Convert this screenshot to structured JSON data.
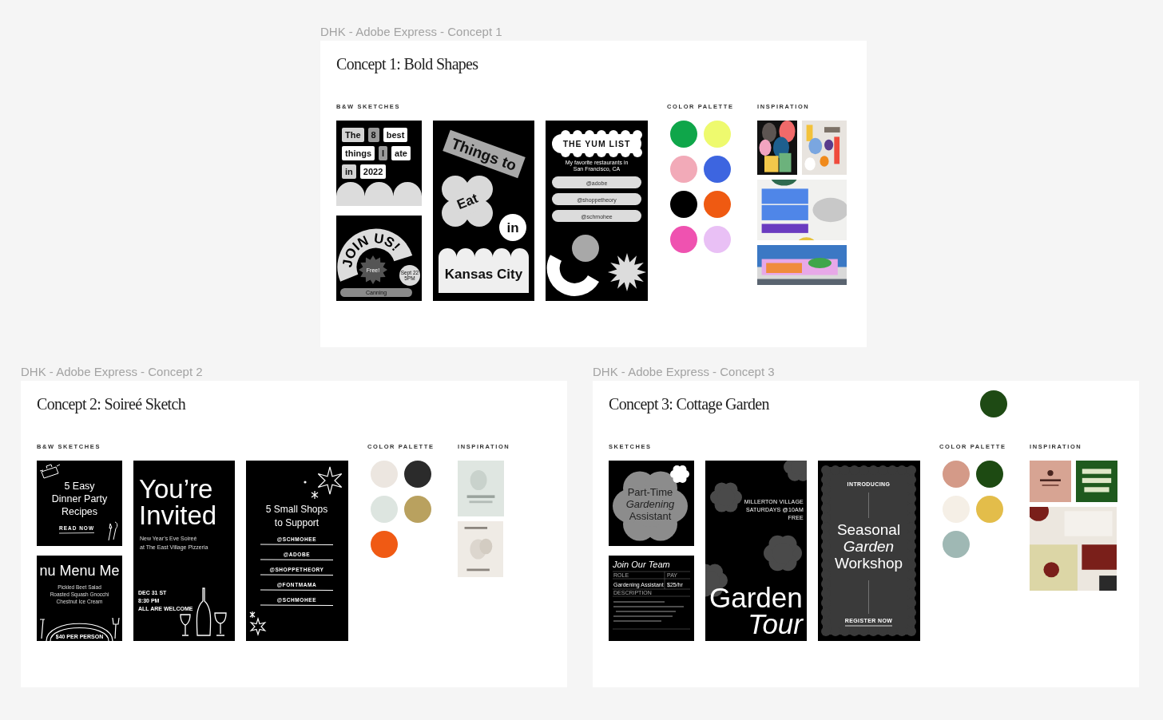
{
  "concepts": [
    {
      "label": "DHK - Adobe Express - Concept 1",
      "title": "Concept 1: Bold Shapes",
      "sketches_heading": "B&W SKETCHES",
      "palette_heading": "COLOR PALETTE",
      "inspiration_heading": "INSPIRATION",
      "sketches": [
        {
          "kind": "word-tiles",
          "rows": [
            [
              {
                "text": "The",
                "color": "#d4d4d4"
              },
              {
                "text": "8",
                "color": "#9a9a9a"
              },
              {
                "text": "best",
                "color": "#ffffff"
              }
            ],
            [
              {
                "text": "things",
                "color": "#ffffff"
              },
              {
                "text": "I",
                "color": "#9a9a9a"
              },
              {
                "text": "ate",
                "color": "#ffffff"
              }
            ],
            [
              {
                "text": "in",
                "color": "#d4d4d4"
              },
              {
                "text": "2022",
                "color": "#ffffff"
              }
            ]
          ]
        },
        {
          "kind": "join-us",
          "arc": "JOIN US!",
          "badge": "Free!",
          "date": [
            "Sept 22",
            "5PM"
          ],
          "bar": "Canning"
        },
        {
          "kind": "things-to-eat",
          "banner": "Things to",
          "flower": "Eat",
          "circle": "in",
          "box": "Kansas City"
        },
        {
          "kind": "yum-list",
          "title": "THE YUM LIST",
          "subtitle": [
            "My favorite restaurants in",
            "San Francisco, CA"
          ],
          "handles": [
            "@adobe",
            "@shoppetheory",
            "@schmohee"
          ]
        }
      ],
      "palette": [
        {
          "color": "#0fa64a"
        },
        {
          "color": "#eefa6e"
        },
        {
          "color": "#f2aab8"
        },
        {
          "color": "#3d65e0"
        },
        {
          "color": "#000000"
        },
        {
          "color": "#ef5a12"
        },
        {
          "color": "#ef52b0"
        },
        {
          "color": "#e9c0f5"
        }
      ],
      "inspiration": [
        {
          "kind": "picture"
        },
        {
          "kind": "picture"
        },
        {
          "kind": "picture"
        },
        {
          "kind": "picture"
        }
      ]
    },
    {
      "label": "DHK - Adobe Express - Concept 2",
      "title": "Concept 2: Soireé Sketch",
      "sketches_heading": "B&W SKETCHES",
      "palette_heading": "COLOR PALETTE",
      "inspiration_heading": "INSPIRATION",
      "sketches": [
        {
          "kind": "recipes",
          "title": [
            "5 Easy",
            "Dinner Party",
            "Recipes"
          ],
          "link": "READ NOW"
        },
        {
          "kind": "menu",
          "title": "nu Menu Me",
          "items": [
            "Pickled Beet Salad",
            "Roasted Squash Gnocchi",
            "Chestnut Ice Cream"
          ],
          "price": "$40 PER PERSON"
        },
        {
          "kind": "invite",
          "title": [
            "You’re",
            "Invited"
          ],
          "subtitle": [
            "New Year’s Eve Soireé",
            "at The East Village Pizzeria"
          ],
          "details": [
            "DEC 31 ST",
            "8:30 PM",
            "ALL ARE WELCOME"
          ]
        },
        {
          "kind": "shops",
          "title": [
            "5 Small Shops",
            "to Support"
          ],
          "handles": [
            "@SCHMOHEE",
            "@ADOBE",
            "@SHOPPETHEORY",
            "@FONTMAMA",
            "@SCHMOHEE"
          ]
        }
      ],
      "palette": [
        {
          "color": "#ece6e0"
        },
        {
          "color": "#2b2b2b"
        },
        {
          "color": "#dde5e0"
        },
        {
          "color": "#b9a15f"
        },
        {
          "color": "#f05a14"
        }
      ],
      "inspiration": [
        {
          "kind": "picture"
        },
        {
          "kind": "picture"
        }
      ]
    },
    {
      "label": "DHK - Adobe Express - Concept 3",
      "title": "Concept 3: Cottage Garden",
      "accent": {
        "color": "#1e4a14"
      },
      "sketches_heading": "SKETCHES",
      "palette_heading": "COLOR PALETTE",
      "inspiration_heading": "INSPIRATION",
      "sketches": [
        {
          "kind": "part-time",
          "title": [
            "Part-Time",
            "Gardening",
            "Assistant"
          ]
        },
        {
          "kind": "join-team",
          "title": "Join Our Team",
          "role_label": "ROLE",
          "pay_label": "PAY",
          "role": "Gardening Assistant",
          "pay": "$25/hr",
          "description_label": "DESCRIPTION"
        },
        {
          "kind": "garden-tour",
          "details": [
            "MILLERTON VILLAGE",
            "SATURDAYS @10AM",
            "FREE"
          ],
          "title": [
            "Garden",
            "Tour"
          ]
        },
        {
          "kind": "workshop",
          "eyebrow": "INTRODUCING",
          "title": [
            "Seasonal",
            "Garden",
            "Workshop"
          ],
          "link": "REGISTER NOW"
        }
      ],
      "palette": [
        {
          "color": "#d49a88"
        },
        {
          "color": "#1d4a12"
        },
        {
          "color": "#f5efe6"
        },
        {
          "color": "#e3bd4a"
        },
        {
          "color": "#9fb8b4"
        }
      ],
      "inspiration": [
        {
          "kind": "picture"
        },
        {
          "kind": "picture"
        },
        {
          "kind": "picture"
        }
      ]
    }
  ]
}
